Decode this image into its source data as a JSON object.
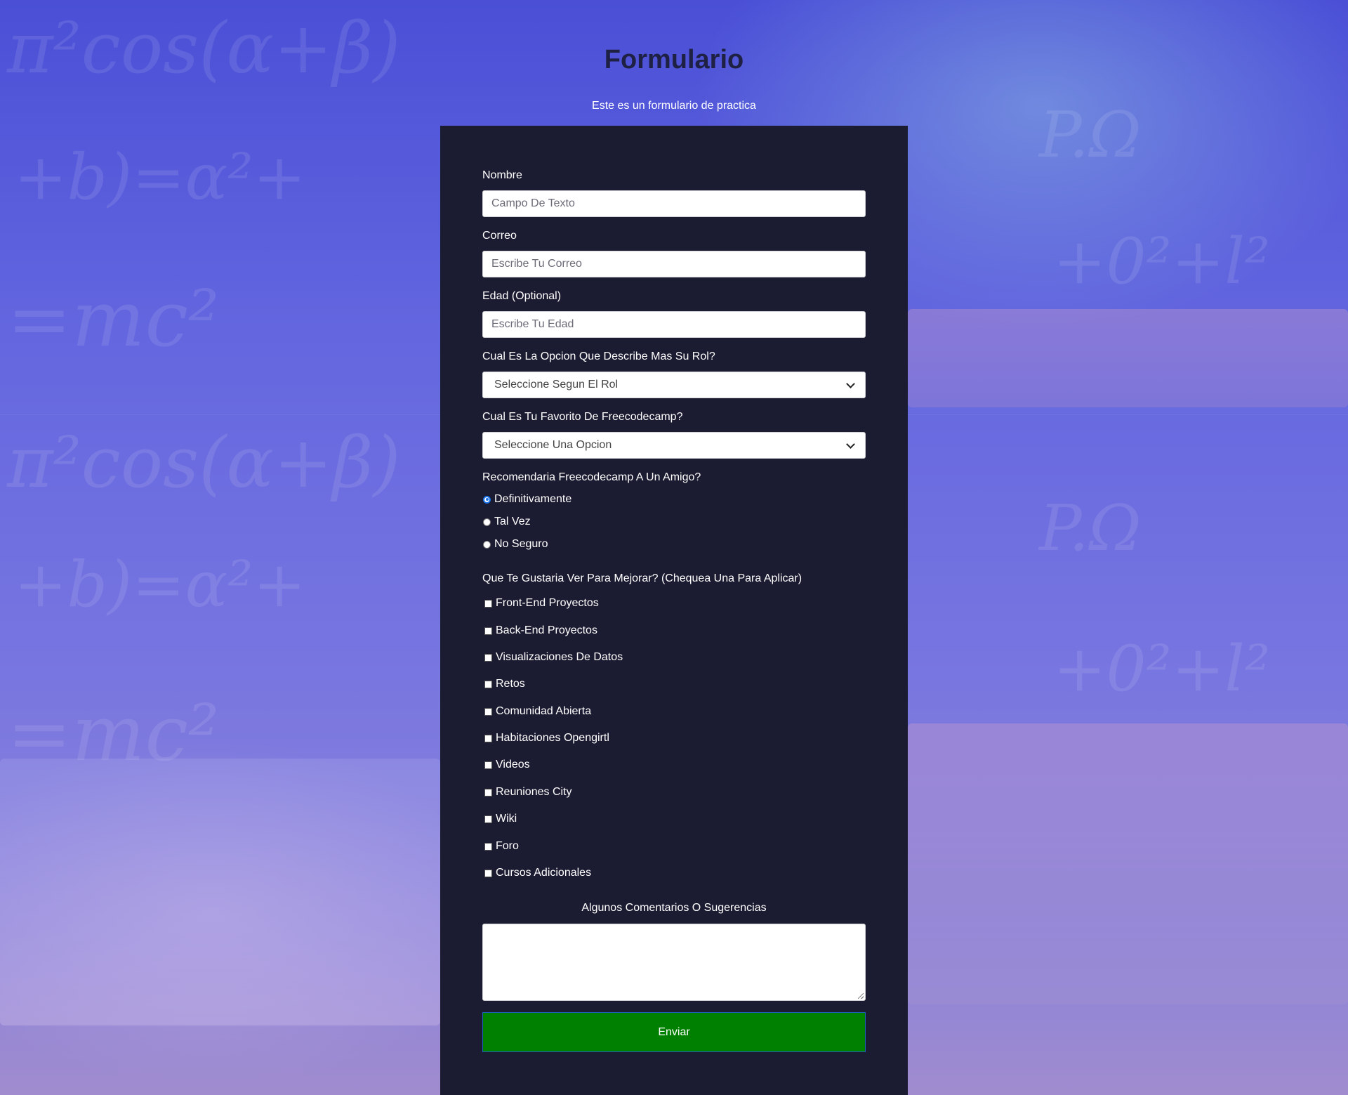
{
  "header": {
    "title": "Formulario",
    "subtitle": "Este es un formulario de practica"
  },
  "form": {
    "name": {
      "label": "Nombre",
      "placeholder": "Campo De Texto"
    },
    "email": {
      "label": "Correo",
      "placeholder": "Escribe Tu Correo"
    },
    "age": {
      "label": "Edad (Optional)",
      "placeholder": "Escribe Tu Edad"
    },
    "role": {
      "label": "Cual Es La Opcion Que Describe Mas Su Rol?",
      "selected": "Seleccione Segun El Rol"
    },
    "favorite": {
      "label": "Cual Es Tu Favorito De Freecodecamp?",
      "selected": "Seleccione Una Opcion"
    },
    "recommend": {
      "label": "Recomendaria Freecodecamp A Un Amigo?",
      "options": [
        {
          "label": "Definitivamente",
          "checked": true
        },
        {
          "label": "Tal Vez",
          "checked": false
        },
        {
          "label": "No Seguro",
          "checked": false
        }
      ]
    },
    "improvements": {
      "label": "Que Te Gustaria Ver Para Mejorar? (Chequea Una Para Aplicar)",
      "options": [
        "Front-End Proyectos",
        "Back-End Proyectos",
        "Visualizaciones De Datos",
        "Retos",
        "Comunidad Abierta",
        "Habitaciones Opengirtl",
        "Videos",
        "Reuniones City",
        "Wiki",
        "Foro",
        "Cursos Adicionales"
      ]
    },
    "comments": {
      "label": "Algunos Comentarios O Sugerencias",
      "value": ""
    },
    "submit_label": "Enviar"
  },
  "colors": {
    "card": "#1b1b32",
    "submit": "#008000",
    "title": "#1f2144"
  }
}
